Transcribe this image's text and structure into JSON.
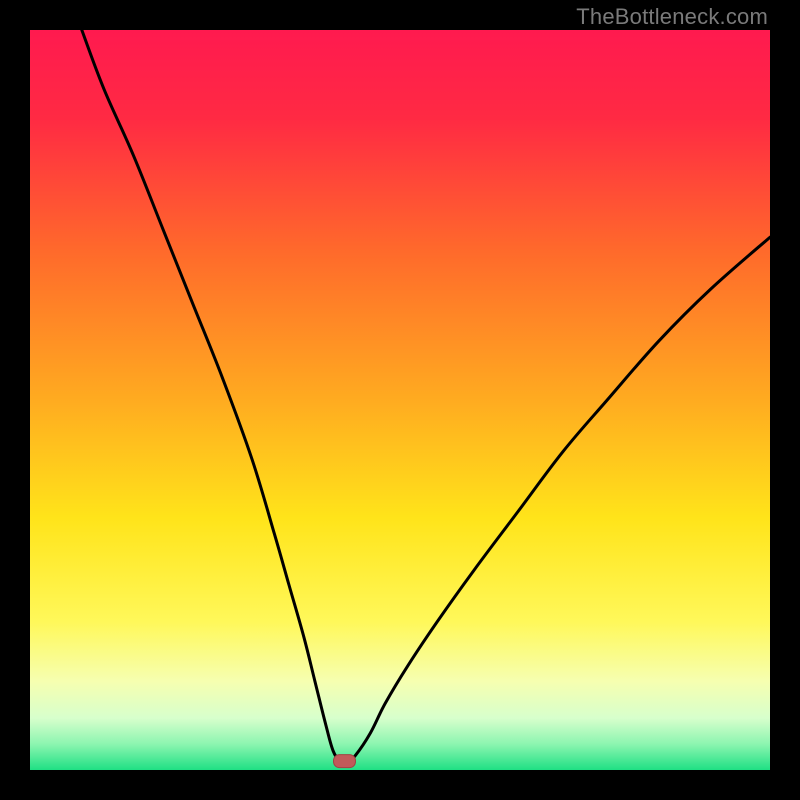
{
  "watermark": "TheBottleneck.com",
  "colors": {
    "frame": "#000000",
    "curve": "#000000",
    "marker_fill": "#c15a5a",
    "marker_stroke": "#a04545",
    "gradient_stops": [
      {
        "offset": 0.0,
        "color": "#ff1a4f"
      },
      {
        "offset": 0.12,
        "color": "#ff2a43"
      },
      {
        "offset": 0.3,
        "color": "#ff6a2b"
      },
      {
        "offset": 0.5,
        "color": "#ffab20"
      },
      {
        "offset": 0.66,
        "color": "#ffe41a"
      },
      {
        "offset": 0.8,
        "color": "#fff85a"
      },
      {
        "offset": 0.88,
        "color": "#f6ffb0"
      },
      {
        "offset": 0.93,
        "color": "#d7ffcc"
      },
      {
        "offset": 0.965,
        "color": "#8cf5b0"
      },
      {
        "offset": 1.0,
        "color": "#1fe084"
      }
    ]
  },
  "chart_data": {
    "type": "line",
    "title": "",
    "xlabel": "",
    "ylabel": "",
    "xlim": [
      0,
      100
    ],
    "ylim": [
      0,
      100
    ],
    "series": [
      {
        "name": "bottleneck-curve",
        "x": [
          7,
          10,
          14,
          18,
          22,
          26,
          30,
          33,
          35,
          37,
          38.5,
          40,
          41,
          42,
          43,
          44,
          46,
          48,
          51,
          55,
          60,
          66,
          72,
          78,
          85,
          92,
          100
        ],
        "values": [
          100,
          92,
          83,
          73,
          63,
          53,
          42,
          32,
          25,
          18,
          12,
          6,
          2.5,
          1.2,
          1.2,
          2,
          5,
          9,
          14,
          20,
          27,
          35,
          43,
          50,
          58,
          65,
          72
        ]
      }
    ],
    "marker": {
      "x": 42.5,
      "y": 1.2,
      "label": "optimal-point"
    }
  }
}
